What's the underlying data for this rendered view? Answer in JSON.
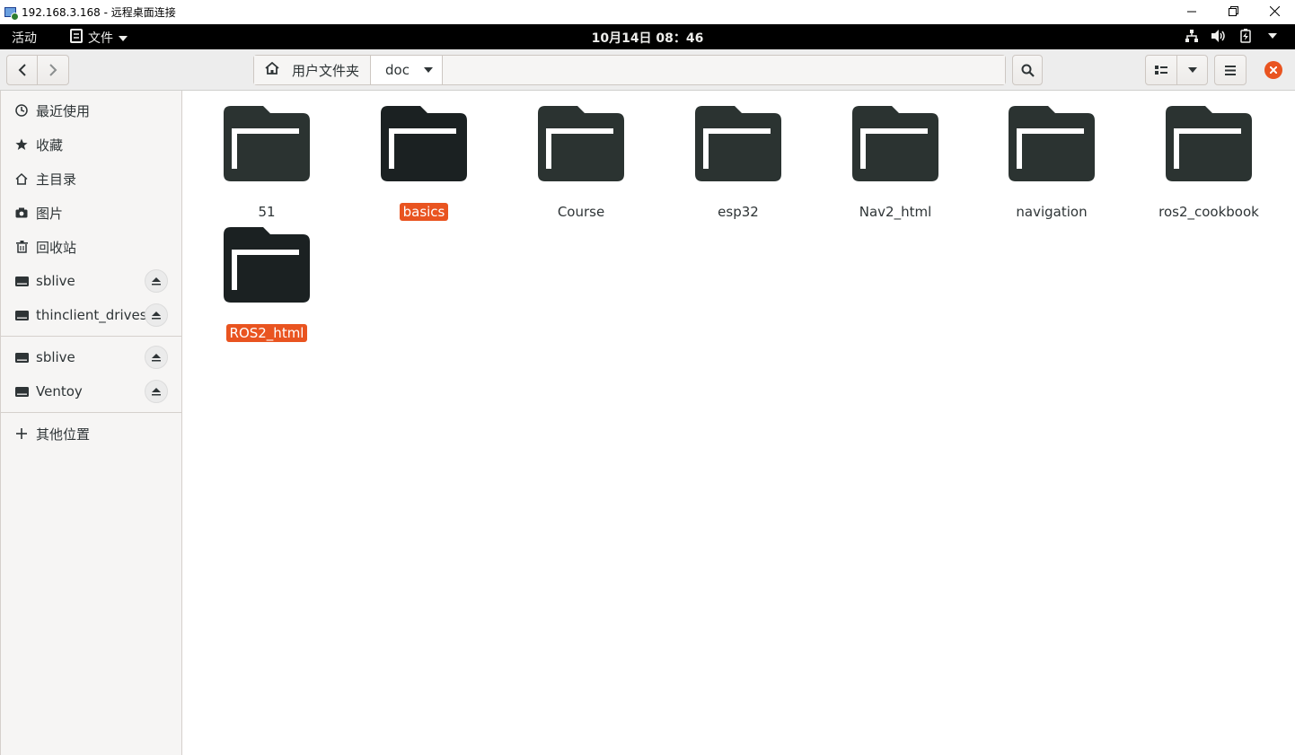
{
  "window": {
    "title": "192.168.3.168 - 远程桌面连接",
    "controls": [
      "minimize",
      "restore",
      "close"
    ]
  },
  "topbar": {
    "activities": "活动",
    "app_name": "文件",
    "clock": "10月14日  08：46",
    "tray_icons": [
      "network-icon",
      "volume-icon",
      "battery-icon",
      "chevron-down-icon"
    ]
  },
  "headerbar": {
    "path": [
      {
        "label": "用户文件夹",
        "icon": "home-icon"
      },
      {
        "label": "doc",
        "icon": "chevron-down-icon"
      }
    ],
    "buttons": [
      "back",
      "forward",
      "search",
      "view-toggle",
      "view-menu",
      "hamburger-menu",
      "close"
    ]
  },
  "sidebar": {
    "items": [
      {
        "label": "最近使用",
        "icon": "clock-icon"
      },
      {
        "label": "收藏",
        "icon": "star-icon"
      },
      {
        "label": "主目录",
        "icon": "home-icon"
      },
      {
        "label": "图片",
        "icon": "camera-icon"
      },
      {
        "label": "回收站",
        "icon": "trash-icon"
      },
      {
        "label": "sblive",
        "icon": "drive-icon",
        "eject": true
      },
      {
        "label": "thinclient_drives",
        "icon": "drive-icon",
        "eject": true
      },
      {
        "label": "sblive",
        "icon": "drive-icon",
        "eject": true
      },
      {
        "label": "Ventoy",
        "icon": "drive-icon",
        "eject": true
      },
      {
        "label": "其他位置",
        "icon": "plus-icon"
      }
    ]
  },
  "folders": [
    {
      "name": "51",
      "selected": false
    },
    {
      "name": "basics",
      "selected": true
    },
    {
      "name": "Course",
      "selected": false
    },
    {
      "name": "esp32",
      "selected": false
    },
    {
      "name": "Nav2_html",
      "selected": false
    },
    {
      "name": "navigation",
      "selected": false
    },
    {
      "name": "ros2_cookbook",
      "selected": false
    },
    {
      "name": "ROS2_html",
      "selected": true
    }
  ],
  "colors": {
    "accent": "#e95420",
    "folder": "#2b3331",
    "folder_selected": "#1b2122",
    "topbar": "#000000"
  }
}
